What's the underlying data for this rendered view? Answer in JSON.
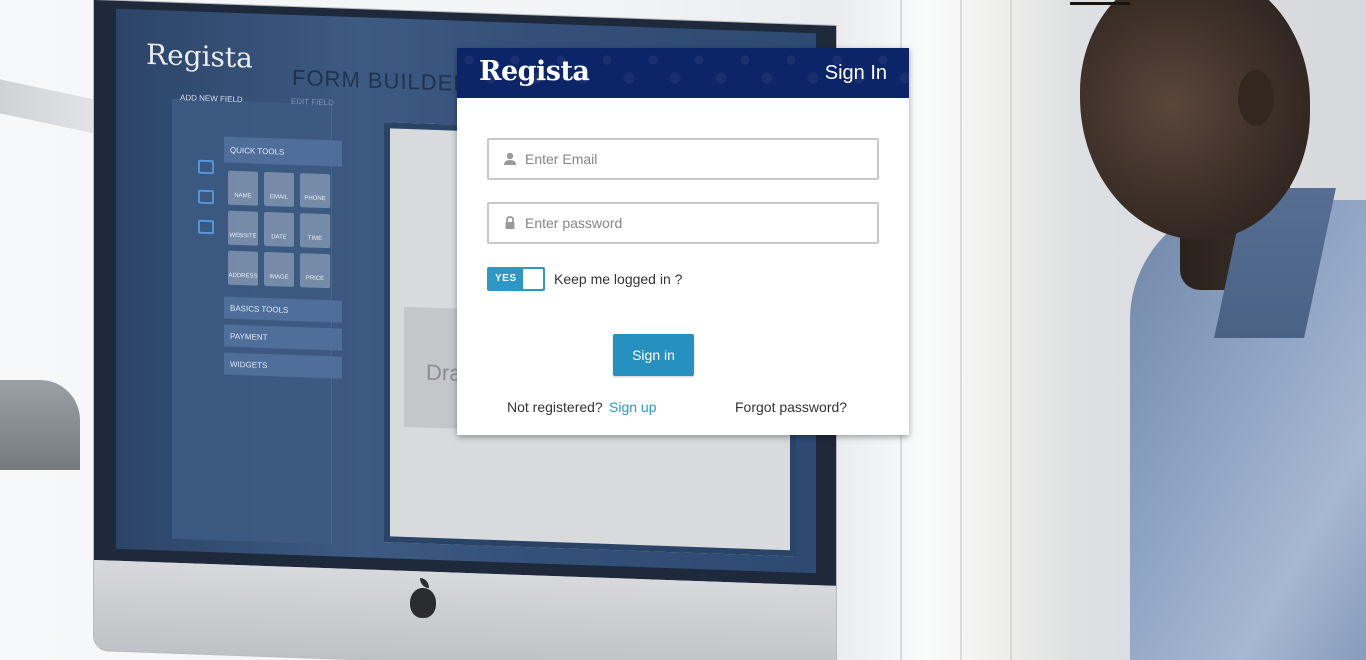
{
  "background": {
    "monitor_logo": "Regista",
    "monitor_title": "FORM BUILDER",
    "tabs": [
      "ADD NEW FIELD",
      "EDIT FIELD"
    ],
    "quick_tools_label": "QUICK TOOLS",
    "tiles": [
      "NAME",
      "EMAIL",
      "PHONE",
      "WEBSITE",
      "DATE",
      "TIME",
      "ADDRESS",
      "IMAGE",
      "PRICE"
    ],
    "categories": [
      "BASICS TOOLS",
      "PAYMENT",
      "WIDGETS"
    ],
    "drag_text": "Drag"
  },
  "login": {
    "brand": "Regista",
    "title": "Sign In",
    "email_placeholder": "Enter Email",
    "password_placeholder": "Enter password",
    "toggle_label": "YES",
    "keep_logged_in": "Keep me logged in ?",
    "signin_button": "Sign in",
    "not_registered": "Not registered?",
    "signup_link": "Sign up",
    "forgot_password": "Forgot password?"
  },
  "colors": {
    "header_bg": "#0c2468",
    "accent": "#2d97c6",
    "button_bg": "#2690c0"
  },
  "icons": {
    "email_field": "user-icon",
    "password_field": "lock-icon"
  }
}
